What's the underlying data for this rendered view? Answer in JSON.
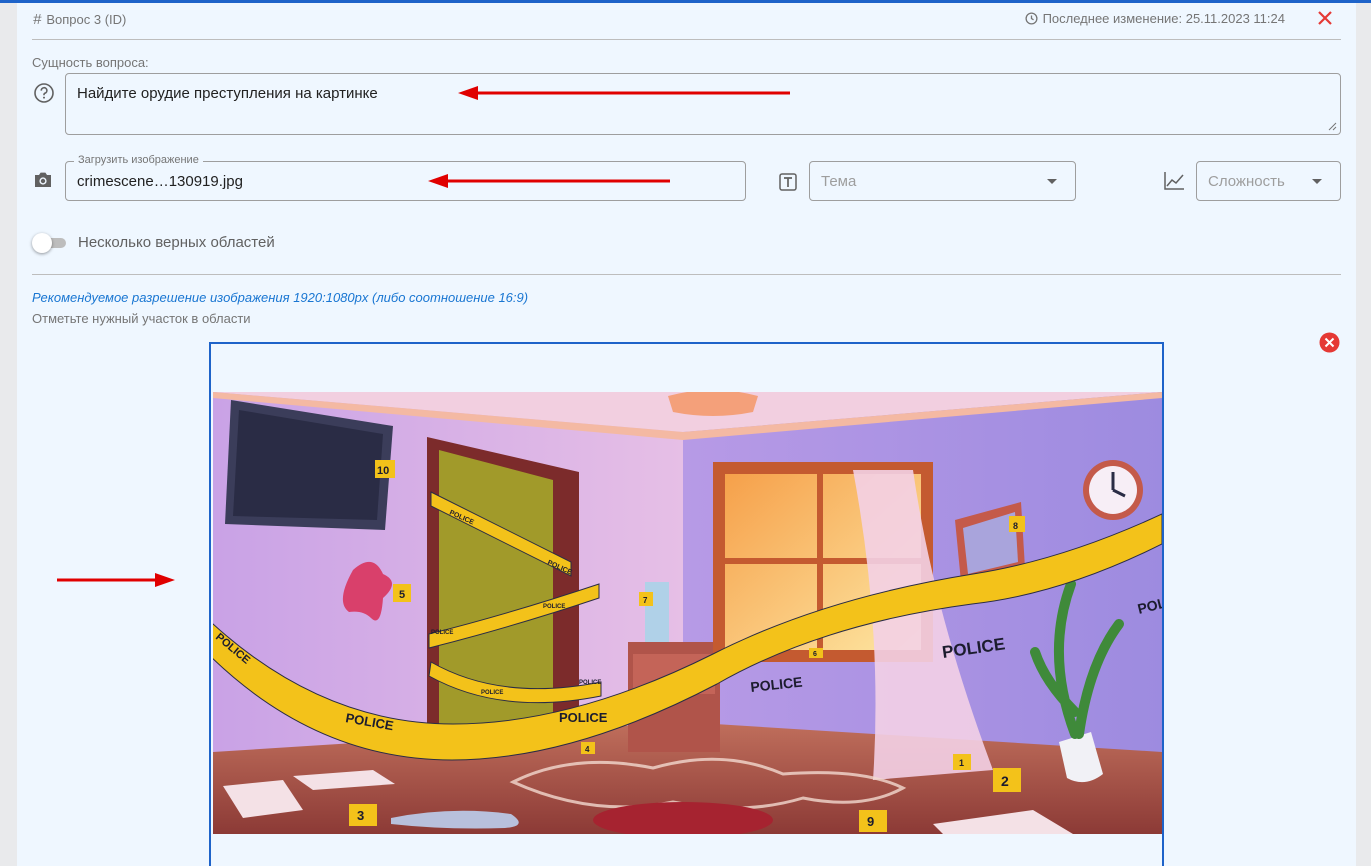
{
  "header": {
    "question_id": "Вопрос 3 (ID)",
    "last_modified": "Последнее изменение: 25.11.2023 11:24"
  },
  "question": {
    "label": "Сущность вопроса:",
    "text": "Найдите орудие преступления на картинке"
  },
  "upload": {
    "legend": "Загрузить изображение",
    "filename": "crimescene…130919.jpg"
  },
  "topic": {
    "placeholder": "Тема"
  },
  "difficulty": {
    "placeholder": "Сложность"
  },
  "multi_areas": {
    "label": "Несколько верных областей",
    "enabled": false
  },
  "resolution_hint": "Рекомендуемое разрешение изображения 1920:1080px (либо соотношение 16:9)",
  "mark_hint": "Отметьте нужный участок в области",
  "scene": {
    "tape_text": "POLICE",
    "evidence_markers": [
      "1",
      "2",
      "3",
      "4",
      "5",
      "6",
      "7",
      "8",
      "9",
      "10"
    ]
  },
  "colors": {
    "accent": "#1e63c9",
    "danger": "#e53935",
    "annotation_arrow": "#e00000",
    "hint": "#1976d2"
  }
}
